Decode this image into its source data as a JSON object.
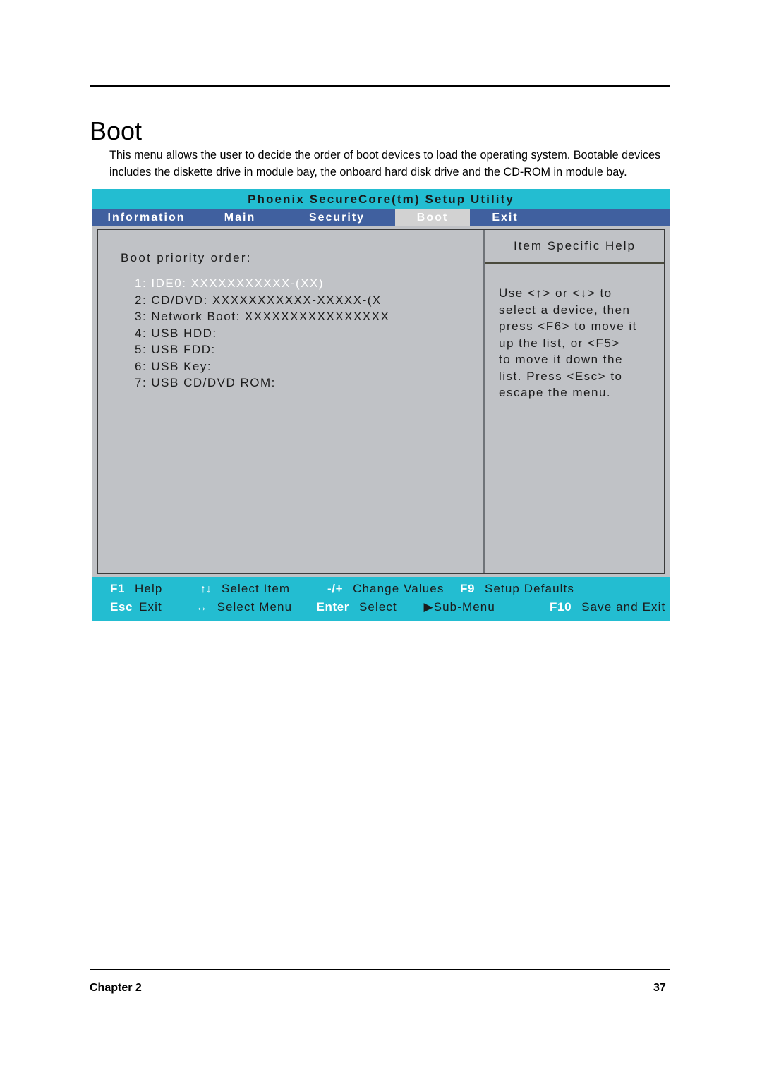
{
  "document": {
    "title": "Boot",
    "intro": "This menu allows the user to decide the order of boot devices to load the operating system. Bootable devices includes the diskette drive in module bay, the onboard hard disk drive and the CD-ROM in module bay.",
    "chapter_label": "Chapter 2",
    "page_number": "37"
  },
  "bios": {
    "utility_title": "Phoenix SecureCore(tm) Setup Utility",
    "tabs": [
      {
        "label": "Information",
        "selected": false
      },
      {
        "label": "Main",
        "selected": false
      },
      {
        "label": "Security",
        "selected": false
      },
      {
        "label": "Boot",
        "selected": true
      },
      {
        "label": "Exit",
        "selected": false
      }
    ],
    "boot": {
      "heading": "Boot priority order:",
      "items": [
        {
          "text": "1: IDE0: XXXXXXXXXXX-(XX)",
          "selected": true
        },
        {
          "text": "2: CD/DVD: XXXXXXXXXXX-XXXXX-(X",
          "selected": false
        },
        {
          "text": "3: Network Boot: XXXXXXXXXXXXXXXX",
          "selected": false
        },
        {
          "text": "4: USB HDD:",
          "selected": false
        },
        {
          "text": "5: USB FDD:",
          "selected": false
        },
        {
          "text": "6: USB Key:",
          "selected": false
        },
        {
          "text": "7: USB CD/DVD ROM:",
          "selected": false
        }
      ]
    },
    "help": {
      "title": "Item Specific Help",
      "lines": [
        "Use <↑> or <↓> to",
        "select a device, then",
        "press <F6> to move it",
        "up the list, or <F5>",
        "to move it down the",
        "list. Press <Esc> to",
        "escape the menu."
      ]
    },
    "footer": {
      "row1": [
        {
          "key": "F1",
          "desc": "Help"
        },
        {
          "key": "↑↓",
          "desc": "Select Item"
        },
        {
          "key": "-/+",
          "desc": "Change Values"
        },
        {
          "key": "F9",
          "desc": "Setup Defaults"
        }
      ],
      "row2": [
        {
          "key": "Esc",
          "desc": "Exit"
        },
        {
          "key": "↔",
          "desc": "Select Menu"
        },
        {
          "key": "Enter",
          "desc": "Select"
        },
        {
          "key": "▶Sub-Menu",
          "desc": ""
        },
        {
          "key": "F10",
          "desc": "Save and Exit"
        }
      ]
    },
    "colors": {
      "title_bar": "#23bdd1",
      "tab_bar": "#40609f",
      "selected_tab_bg": "#d2d2d2",
      "panel_bg": "#c0c2c6",
      "footer_bar": "#23bdd1"
    }
  }
}
